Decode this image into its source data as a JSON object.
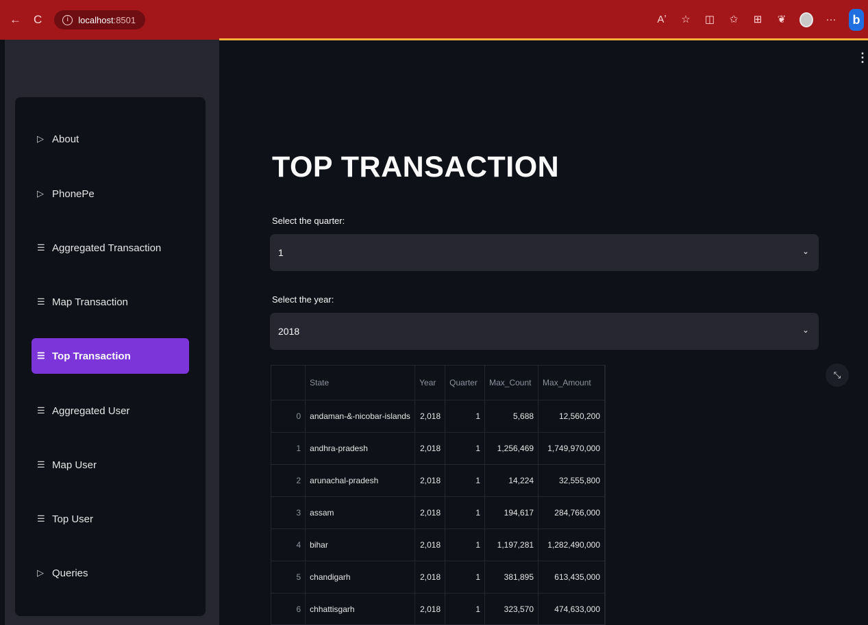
{
  "browser": {
    "url_host": "localhost",
    "url_port": ":8501",
    "back_glyph": "←",
    "reload_glyph": "C",
    "toolbar_icons": [
      "Aʼ",
      "☆",
      "◫",
      "✩",
      "⊞",
      "❦"
    ]
  },
  "sidebar": {
    "items": [
      {
        "label": "About",
        "icon": "▷"
      },
      {
        "label": "PhonePe",
        "icon": "▷"
      },
      {
        "label": "Aggregated Transaction",
        "icon": "☰"
      },
      {
        "label": "Map Transaction",
        "icon": "☰"
      },
      {
        "label": "Top Transaction",
        "icon": "☰",
        "active": true
      },
      {
        "label": "Aggregated User",
        "icon": "☰"
      },
      {
        "label": "Map User",
        "icon": "☰"
      },
      {
        "label": "Top User",
        "icon": "☰"
      },
      {
        "label": "Queries",
        "icon": "▷"
      }
    ]
  },
  "main": {
    "title": "TOP TRANSACTION",
    "quarter": {
      "label": "Select the quarter:",
      "value": "1"
    },
    "year": {
      "label": "Select the year:",
      "value": "2018"
    },
    "table": {
      "columns": [
        "",
        "State",
        "Year",
        "Quarter",
        "Max_Count",
        "Max_Amount"
      ],
      "rows": [
        [
          "0",
          "andaman-&-nicobar-islands",
          "2,018",
          "1",
          "5,688",
          "12,560,200"
        ],
        [
          "1",
          "andhra-pradesh",
          "2,018",
          "1",
          "1,256,469",
          "1,749,970,000"
        ],
        [
          "2",
          "arunachal-pradesh",
          "2,018",
          "1",
          "14,224",
          "32,555,800"
        ],
        [
          "3",
          "assam",
          "2,018",
          "1",
          "194,617",
          "284,766,000"
        ],
        [
          "4",
          "bihar",
          "2,018",
          "1",
          "1,197,281",
          "1,282,490,000"
        ],
        [
          "5",
          "chandigarh",
          "2,018",
          "1",
          "381,895",
          "613,435,000"
        ],
        [
          "6",
          "chhattisgarh",
          "2,018",
          "1",
          "323,570",
          "474,633,000"
        ]
      ]
    }
  },
  "colors": {
    "browser_bar": "#a3171b",
    "accent_line": "#f4b23c",
    "active_item": "#7b35d8",
    "app_bg": "#0e1117",
    "sidebar_bg": "#262730"
  }
}
